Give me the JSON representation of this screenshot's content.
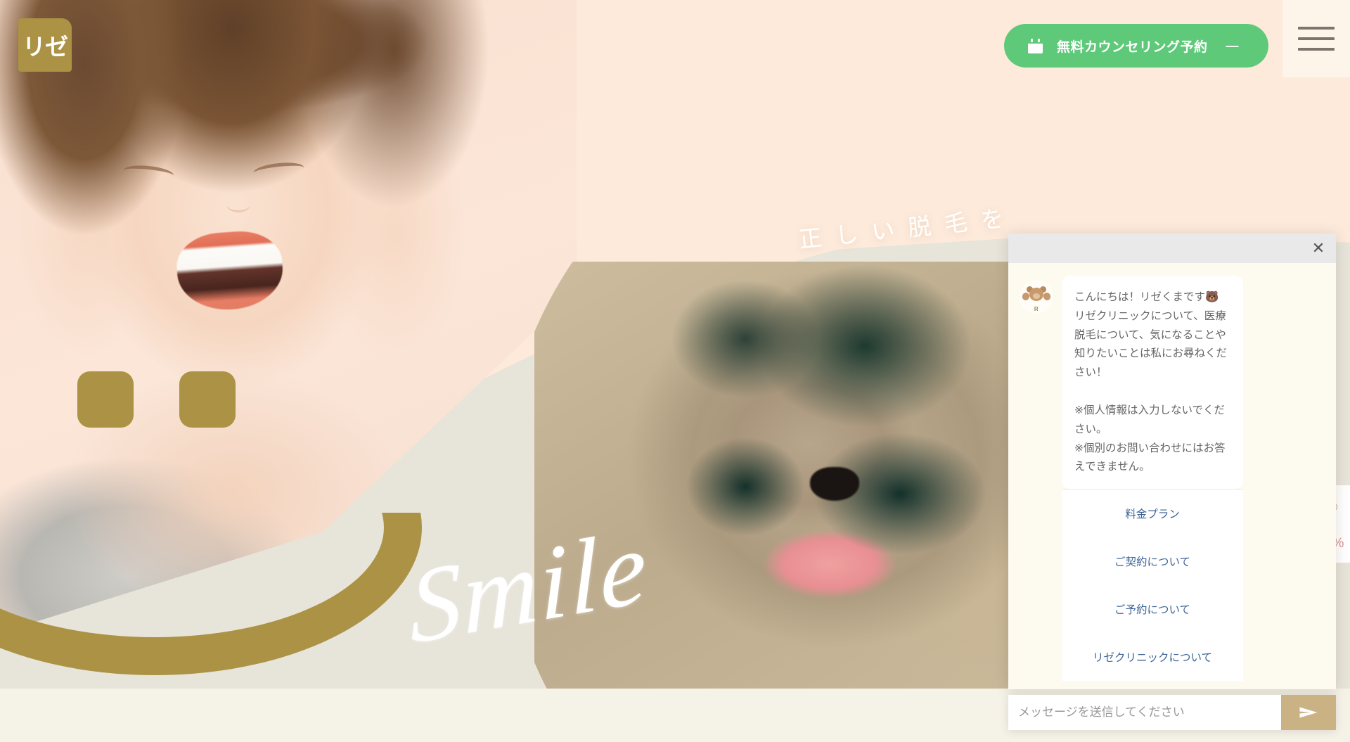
{
  "header": {
    "logo_text": "リゼ",
    "cta_label": "無料カウンセリング予約",
    "cta_dash": "—",
    "calendar_icon": "calendar-icon",
    "menu_icon": "hamburger-menu-icon"
  },
  "hero": {
    "heading": "正しい脱毛を",
    "script_word": "Smile"
  },
  "edge_badge": {
    "glyph": "》",
    "percent": "%"
  },
  "chat": {
    "close_label": "✕",
    "avatar_initial": "R",
    "avatar_icon": "teddy-bear-icon",
    "greeting": "こんにちは！リゼくまです🐻\nリゼクリニックについて、医療脱毛について、気になることや知りたいことは私にお尋ねください！\n\n※個人情報は入力しないでください。\n※個別のお問い合わせにはお答えできません。",
    "quick_links": [
      {
        "label": "料金プラン"
      },
      {
        "label": "ご契約について"
      },
      {
        "label": "ご予約について"
      },
      {
        "label": "リゼクリニックについて"
      }
    ],
    "input_placeholder": "メッセージを送信してください",
    "input_value": "",
    "send_icon": "paper-plane-icon"
  },
  "colors": {
    "brand_gold": "#ab9244",
    "cta_green": "#5fc97a",
    "bg_peach": "#fdeadb",
    "beige": "#e7e4da",
    "chat_body": "#fdfaf0",
    "link_blue": "#3f6596",
    "send_tan": "#cbb284"
  }
}
